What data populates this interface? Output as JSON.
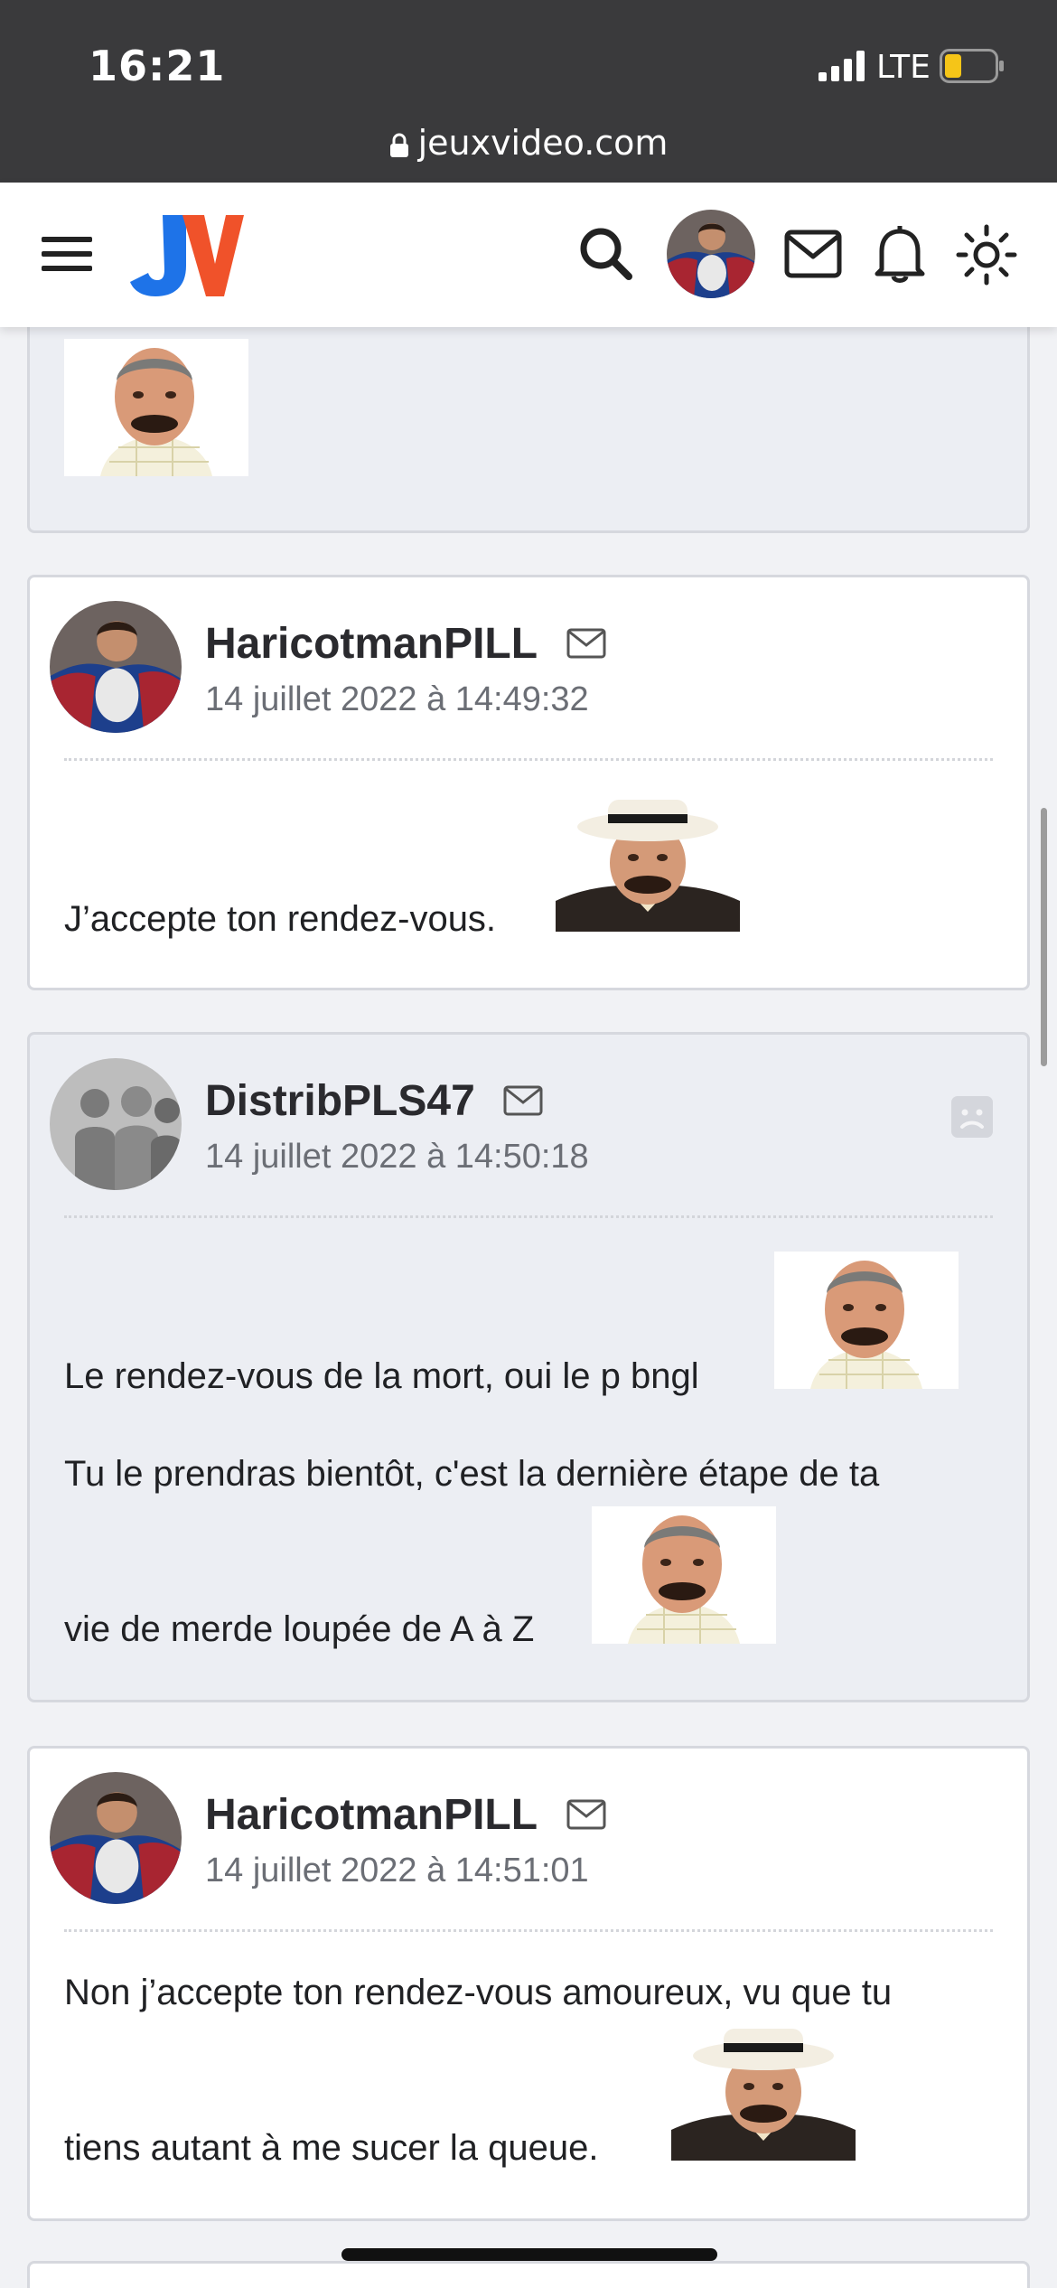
{
  "status_bar": {
    "time": "16:21",
    "network": "LTE",
    "url": "jeuxvideo.com",
    "battery_color": "#f5c518"
  },
  "header": {
    "logo_text": "JV",
    "logo_colors": [
      "#1e73e8",
      "#f0522a"
    ],
    "icons": [
      "menu-icon",
      "search-icon",
      "user-avatar",
      "mail-icon",
      "bell-icon",
      "sun-icon"
    ]
  },
  "posts": [
    {
      "type": "partial",
      "background": "grey"
    },
    {
      "author": "HaricotmanPILL",
      "date": "14 juillet 2022 à 14:49:32",
      "background": "white",
      "lines": [
        "J’accepte ton rendez-vous."
      ]
    },
    {
      "author": "DistribPLS47",
      "date": "14 juillet 2022 à 14:50:18",
      "background": "grey",
      "lines": [
        "Le rendez-vous de la mort, oui le p bngl",
        "Tu le prendras bientôt, c'est la dernière étape de ta",
        "vie de merde loupée de A à Z"
      ]
    },
    {
      "author": "HaricotmanPILL",
      "date": "14 juillet 2022 à 14:51:01",
      "background": "white",
      "lines": [
        "Non j’accepte ton rendez-vous amoureux, vu que tu",
        "tiens autant à me sucer la queue."
      ]
    }
  ]
}
